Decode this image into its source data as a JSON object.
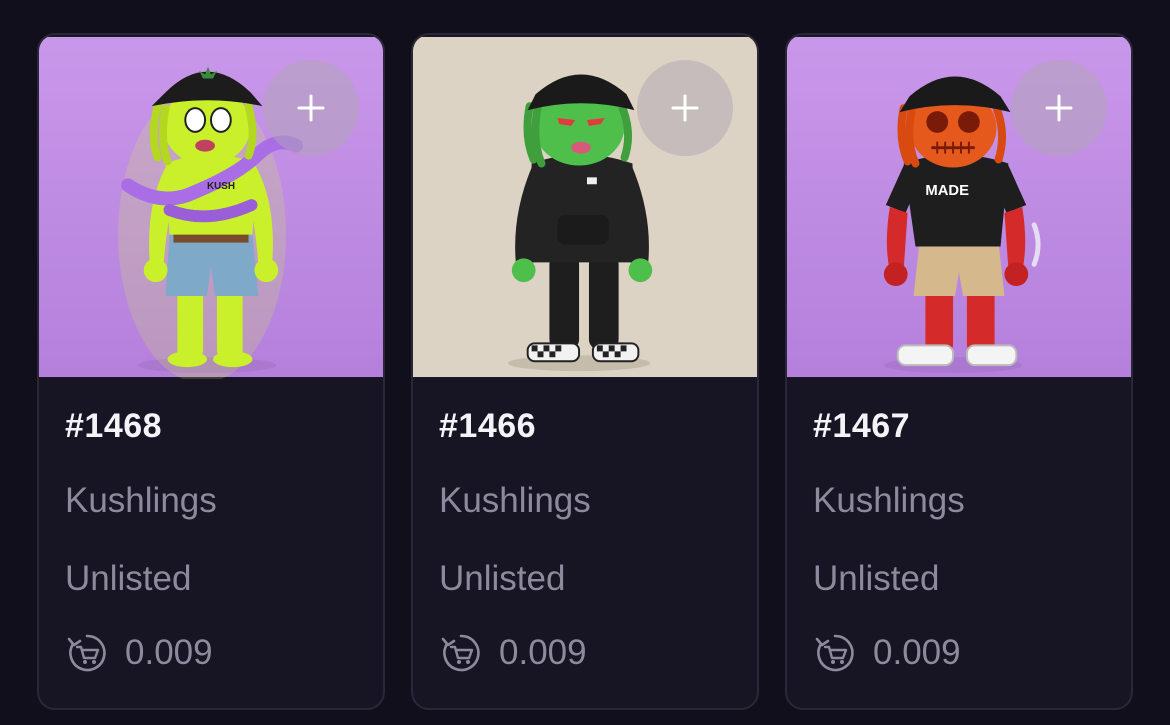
{
  "cards": [
    {
      "id": "#1468",
      "collection": "Kushlings",
      "status": "Unlisted",
      "price": "0.009",
      "background": "#c88fe6",
      "skin": "#c9f02a",
      "hat": "#1a1a1a",
      "shirt": "KUSH"
    },
    {
      "id": "#1466",
      "collection": "Kushlings",
      "status": "Unlisted",
      "price": "0.009",
      "background": "#ddd3c4",
      "skin": "#4fbf4c",
      "hat": "#1a1a1a",
      "shirt": ""
    },
    {
      "id": "#1467",
      "collection": "Kushlings",
      "status": "Unlisted",
      "price": "0.009",
      "background": "#c88fe6",
      "skin": "#e55a1c",
      "hat": "#1a1a1a",
      "shirt": "MADE"
    }
  ],
  "icons": {
    "add": "plus-icon",
    "price": "cart-refresh-icon"
  }
}
